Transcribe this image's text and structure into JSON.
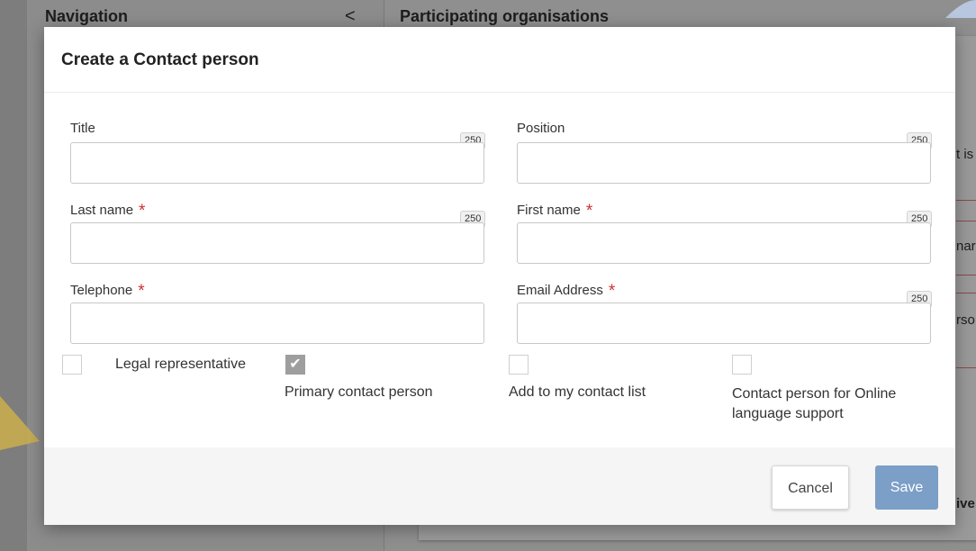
{
  "background": {
    "nav_title": "Navigation",
    "nav_chevron": "<",
    "main_title": "Participating organisations",
    "snippets": [
      "t is",
      "nar",
      "rso",
      "ive"
    ]
  },
  "modal": {
    "title": "Create a Contact person",
    "fields": {
      "title": {
        "label": "Title",
        "value": "",
        "counter": "250"
      },
      "position": {
        "label": "Position",
        "value": "",
        "counter": "250"
      },
      "last_name": {
        "label": "Last name",
        "required": "*",
        "value": "",
        "counter": "250"
      },
      "first_name": {
        "label": "First name",
        "required": "*",
        "value": "",
        "counter": "250"
      },
      "telephone": {
        "label": "Telephone",
        "required": "*",
        "value": ""
      },
      "email": {
        "label": "Email Address",
        "required": "*",
        "value": "",
        "counter": "250"
      }
    },
    "checkboxes": {
      "legal_representative": {
        "label": "Legal representative",
        "checked": false
      },
      "primary_contact": {
        "label": "Primary contact person",
        "checked": true,
        "check_glyph": "✔"
      },
      "add_to_contacts": {
        "label": "Add to my contact list",
        "checked": false
      },
      "online_language_support": {
        "label": "Contact person for Online language support",
        "checked": false
      }
    },
    "buttons": {
      "cancel": "Cancel",
      "save": "Save"
    }
  },
  "colors": {
    "save_button": "#7b9fc7",
    "required": "#d32f2f"
  }
}
